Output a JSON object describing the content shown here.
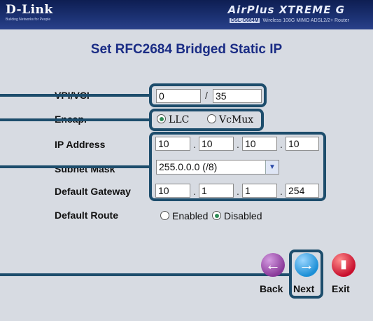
{
  "header": {
    "logo": "D-Link",
    "tagline": "Building Networks for People",
    "brand": "AirPlus XTREME G",
    "model_chip": "DSL-G684M",
    "model_text": "Wireless 108G MIMO ADSL2/2+ Router"
  },
  "page": {
    "title": "Set RFC2684 Bridged Static IP"
  },
  "form": {
    "vpi_vci_label": "VPI/VCI",
    "vpi": "0",
    "separator": "/",
    "vci": "35",
    "encap_label": "Encap.",
    "encap_llc": "LLC",
    "encap_vcmux": "VcMux",
    "encap_selected": "LLC",
    "ip_label": "IP Address",
    "ip": [
      "10",
      "10",
      "10",
      "10"
    ],
    "subnet_label": "Subnet Mask",
    "subnet_value": "255.0.0.0 (/8)",
    "gateway_label": "Default Gateway",
    "gateway": [
      "10",
      "1",
      "1",
      "254"
    ],
    "route_label": "Default Route",
    "route_enabled": "Enabled",
    "route_disabled": "Disabled",
    "route_selected": "Disabled"
  },
  "nav": {
    "back": "Back",
    "next": "Next",
    "exit": "Exit"
  },
  "colors": {
    "header": "#1c3274",
    "title": "#1a2c85",
    "highlight": "#1d4d6c",
    "back": "#8a3a9a",
    "next": "#1c8fd6",
    "exit": "#c8102e"
  }
}
